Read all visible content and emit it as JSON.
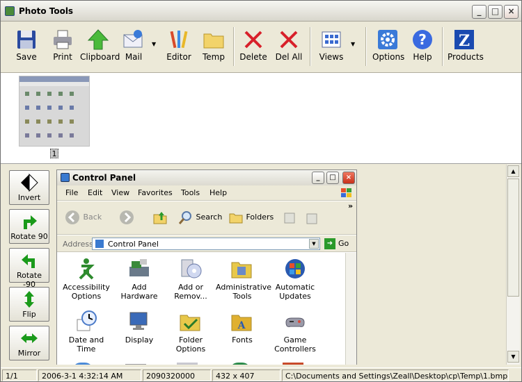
{
  "app": {
    "title": "Photo Tools",
    "minimize": "_",
    "maximize": "□",
    "close": "×"
  },
  "toolbar": [
    {
      "label": "Save",
      "icon": "floppy-icon"
    },
    {
      "label": "Print",
      "icon": "printer-icon"
    },
    {
      "label": "Clipboard",
      "icon": "up-arrow-icon"
    },
    {
      "label": "Mail",
      "icon": "mail-icon"
    },
    {
      "label": "Editor",
      "icon": "brushes-icon"
    },
    {
      "label": "Temp",
      "icon": "folder-icon"
    },
    {
      "label": "Delete",
      "icon": "red-x-icon"
    },
    {
      "label": "Del All",
      "icon": "red-x-icon"
    },
    {
      "label": "Views",
      "icon": "views-grid-icon"
    },
    {
      "label": "Options",
      "icon": "gear-icon"
    },
    {
      "label": "Help",
      "icon": "question-icon"
    },
    {
      "label": "Products",
      "icon": "z-logo-icon"
    }
  ],
  "dropdown_arrow": "▼",
  "thumbnail": {
    "number": "1"
  },
  "leftpanel": [
    {
      "label": "Invert",
      "icon": "diamond-icon"
    },
    {
      "label": "Rotate 90",
      "icon": "rotate-right-icon"
    },
    {
      "label": "Rotate -90",
      "icon": "rotate-left-icon"
    },
    {
      "label": "Flip",
      "icon": "flip-icon"
    },
    {
      "label": "Mirror",
      "icon": "mirror-icon"
    }
  ],
  "scroll": {
    "up": "▲",
    "down": "▼"
  },
  "controlpanel": {
    "title": "Control Panel",
    "minimize": "_",
    "maximize": "□",
    "close": "×",
    "menu": [
      "File",
      "Edit",
      "View",
      "Favorites",
      "Tools",
      "Help"
    ],
    "nav": {
      "back": "Back",
      "search": "Search",
      "folders": "Folders",
      "more": "»"
    },
    "address_label": "Address",
    "address_value": "Control Panel",
    "go_label": "Go",
    "go_arrow": "➜",
    "dropdown_arrow": "▼",
    "icons": [
      {
        "label": "Accessibility Options",
        "color": "#2e8b2e"
      },
      {
        "label": "Add Hardware",
        "color": "#5a6a7a"
      },
      {
        "label": "Add or Remov...",
        "color": "#7a8aa0"
      },
      {
        "label": "Administrative Tools",
        "color": "#c8a040"
      },
      {
        "label": "Automatic Updates",
        "color": "#2a5ab0"
      },
      {
        "label": "Date and Time",
        "color": "#4a7ac8"
      },
      {
        "label": "Display",
        "color": "#3a6ab8"
      },
      {
        "label": "Folder Options",
        "color": "#e8c84a"
      },
      {
        "label": "Fonts",
        "color": "#e0b030"
      },
      {
        "label": "Game Controllers",
        "color": "#7a7a8a"
      }
    ]
  },
  "status": {
    "page": "1/1",
    "date": "2006-3-1 4:32:14 AM",
    "size": "2090320000",
    "dimensions": "432 x 407",
    "path": "C:\\Documents and Settings\\Zeall\\Desktop\\cp\\Temp\\1.bmp"
  }
}
